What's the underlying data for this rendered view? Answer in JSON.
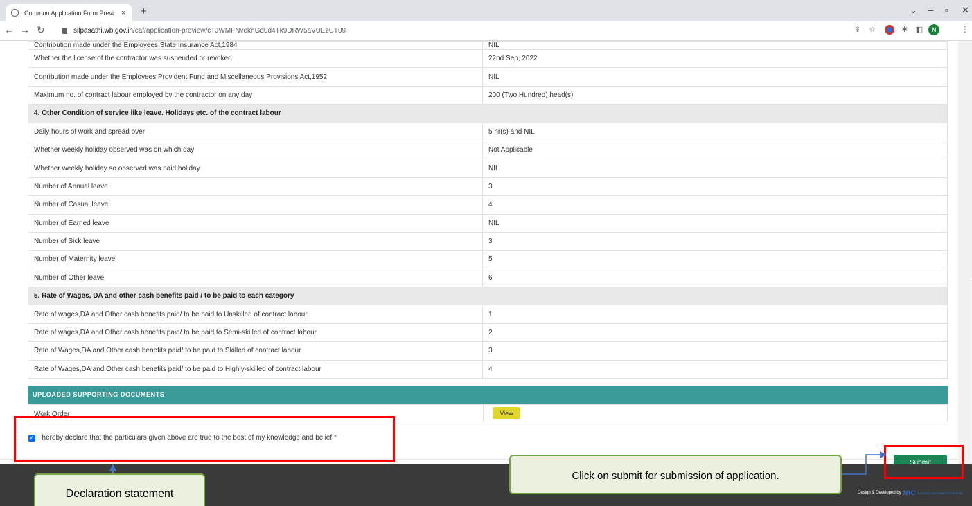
{
  "browser": {
    "tab_title": "Common Application Form Previ",
    "tab_close": "×",
    "new_tab": "+",
    "url_host": "silpasathi.wb.gov.in",
    "url_path": "/caf/application-preview/cTJWMFNvekhGd0d4Tk9DRW5aVUEzUT09",
    "avatar_letter": "N",
    "icons": [
      "back-icon",
      "forward-icon",
      "reload-icon",
      "lock-icon",
      "share-icon",
      "star-icon",
      "recorder-icon",
      "puzzle-icon",
      "sidepanel-icon",
      "menu-icon"
    ]
  },
  "rows": {
    "r0": {
      "label": "Contribution made under the Employees State Insurance Act,1984",
      "value": "NIL"
    },
    "r1": {
      "label": "Whether the license of the contractor was suspended or revoked",
      "value": "22nd Sep, 2022"
    },
    "r2": {
      "label": "Conribution made under the Employees Provident Fund and Miscellaneous Provisions Act,1952",
      "value": "NIL"
    },
    "r3": {
      "label": "Maximum no. of contract labour employed by the contractor on any day",
      "value": "200 (Two Hundred) head(s)"
    },
    "s4": "4. Other Condition of service like leave. Holidays etc. of the contract labour",
    "r4": {
      "label": "Daily hours of work and spread over",
      "value": "5 hr(s) and NIL"
    },
    "r5": {
      "label": "Whether weekly holiday observed was on which day",
      "value": "Not Applicable"
    },
    "r6": {
      "label": "Whether weekly holiday so observed was paid holiday",
      "value": "NIL"
    },
    "r7": {
      "label": "Number of Annual leave",
      "value": "3"
    },
    "r8": {
      "label": "Number of Casual leave",
      "value": "4"
    },
    "r9": {
      "label": "Number of Earned leave",
      "value": "NIL"
    },
    "r10": {
      "label": "Number of Sick leave",
      "value": "3"
    },
    "r11": {
      "label": "Number of Maternity leave",
      "value": "5"
    },
    "r12": {
      "label": "Number of Other leave",
      "value": "6"
    },
    "s5": "5. Rate of Wages, DA and other cash benefits paid / to be paid to each category",
    "r13": {
      "label": "Rate of wages,DA and Other cash benefits paid/ to be paid to Unskilled of contract labour",
      "value": "1"
    },
    "r14": {
      "label": "Rate of wages,DA and Other cash benefits paid/ to be paid to Semi-skilled of contract labour",
      "value": "2"
    },
    "r15": {
      "label": "Rate of Wages,DA and Other cash benefits paid/ to be paid to Skilled of contract labour",
      "value": "3"
    },
    "r16": {
      "label": "Rate of Wages,DA and Other cash benefits paid/ to be paid to Highly-skilled of contract labour",
      "value": "4"
    }
  },
  "docs": {
    "header": "UPLOADED SUPPORTING DOCUMENTS",
    "item_label": "Work Order",
    "view_label": "View"
  },
  "declaration": {
    "text": "I hereby declare that the particulars given above are true to the best of my knowledge and belief",
    "required_mark": "*",
    "checked": true
  },
  "submit_label": "Submit",
  "footer_credit": "Design & Developed by",
  "footer_logo": "NIC",
  "footer_logo_sub": "NATIONAL INFORMATICS CENTRE",
  "annotations": {
    "declaration_callout": "Declaration statement",
    "submit_callout": "Click on submit for submission of application."
  },
  "colors": {
    "docs_header_bg": "#3a9a97",
    "submit_bg": "#198754",
    "view_bg": "#e1d72c",
    "annotation_red": "#ff0000",
    "callout_bg": "#ebf1de",
    "callout_border": "#77a73f",
    "arrow": "#4472c4"
  }
}
